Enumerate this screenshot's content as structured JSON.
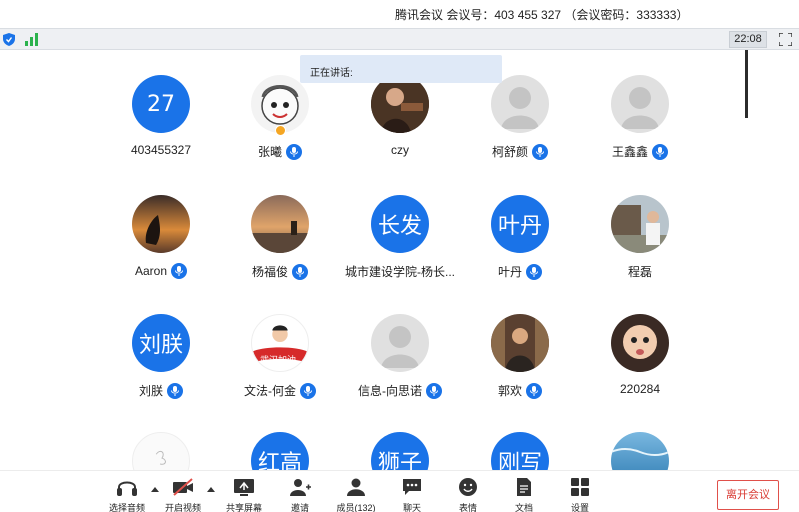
{
  "window": {
    "title": "腾讯会议 会议号：403 455 327 （会议密码：333333）",
    "time": "22:08"
  },
  "speaking": {
    "label": "正在讲话:"
  },
  "participants": [
    {
      "name": "403455327",
      "avatar_text": "27",
      "avatar_type": "text",
      "mic": false
    },
    {
      "name": "张曦",
      "avatar_type": "photo",
      "mic": true,
      "host_badge": true
    },
    {
      "name": "czy",
      "avatar_type": "photo",
      "mic": false
    },
    {
      "name": "柯舒颜",
      "avatar_type": "default",
      "mic": true
    },
    {
      "name": "王鑫鑫",
      "avatar_type": "default",
      "mic": true
    },
    {
      "name": "Aaron",
      "avatar_type": "photo",
      "mic": true
    },
    {
      "name": "杨福俊",
      "avatar_type": "photo",
      "mic": true
    },
    {
      "name": "城市建设学院-杨长...",
      "avatar_text": "长发",
      "avatar_type": "text",
      "mic": false
    },
    {
      "name": "叶丹",
      "avatar_text": "叶丹",
      "avatar_type": "text",
      "mic": true
    },
    {
      "name": "程磊",
      "avatar_type": "photo",
      "mic": false
    },
    {
      "name": "刘朕",
      "avatar_text": "刘朕",
      "avatar_type": "text",
      "mic": true
    },
    {
      "name": "文法-何金",
      "avatar_type": "photo",
      "avatar_caption": "武汉加油",
      "mic": true
    },
    {
      "name": "信息-向思诺",
      "avatar_type": "default",
      "mic": true
    },
    {
      "name": "郭欢",
      "avatar_type": "photo",
      "mic": true
    },
    {
      "name": "220284",
      "avatar_type": "photo",
      "mic": false
    }
  ],
  "partial_row": [
    {
      "avatar_type": "photo"
    },
    {
      "avatar_text": "红高",
      "avatar_type": "text"
    },
    {
      "avatar_text": "狮子",
      "avatar_type": "text"
    },
    {
      "avatar_text": "刚写",
      "avatar_type": "text"
    },
    {
      "avatar_type": "photo"
    }
  ],
  "toolbar": {
    "audio": "选择音频",
    "video": "开启视频",
    "share": "共享屏幕",
    "invite": "邀请",
    "members": "成员(132)",
    "chat": "聊天",
    "emoji": "表情",
    "docs": "文档",
    "settings": "设置",
    "leave": "离开会议"
  },
  "icons": {
    "security": "shield-icon",
    "network": "signal-bars-icon",
    "fullscreen": "fullscreen-icon",
    "mic": "microphone-icon"
  },
  "colors": {
    "accent": "#1a73e8",
    "leave": "#d93a33",
    "speaking_bg": "#dfe9f7"
  }
}
